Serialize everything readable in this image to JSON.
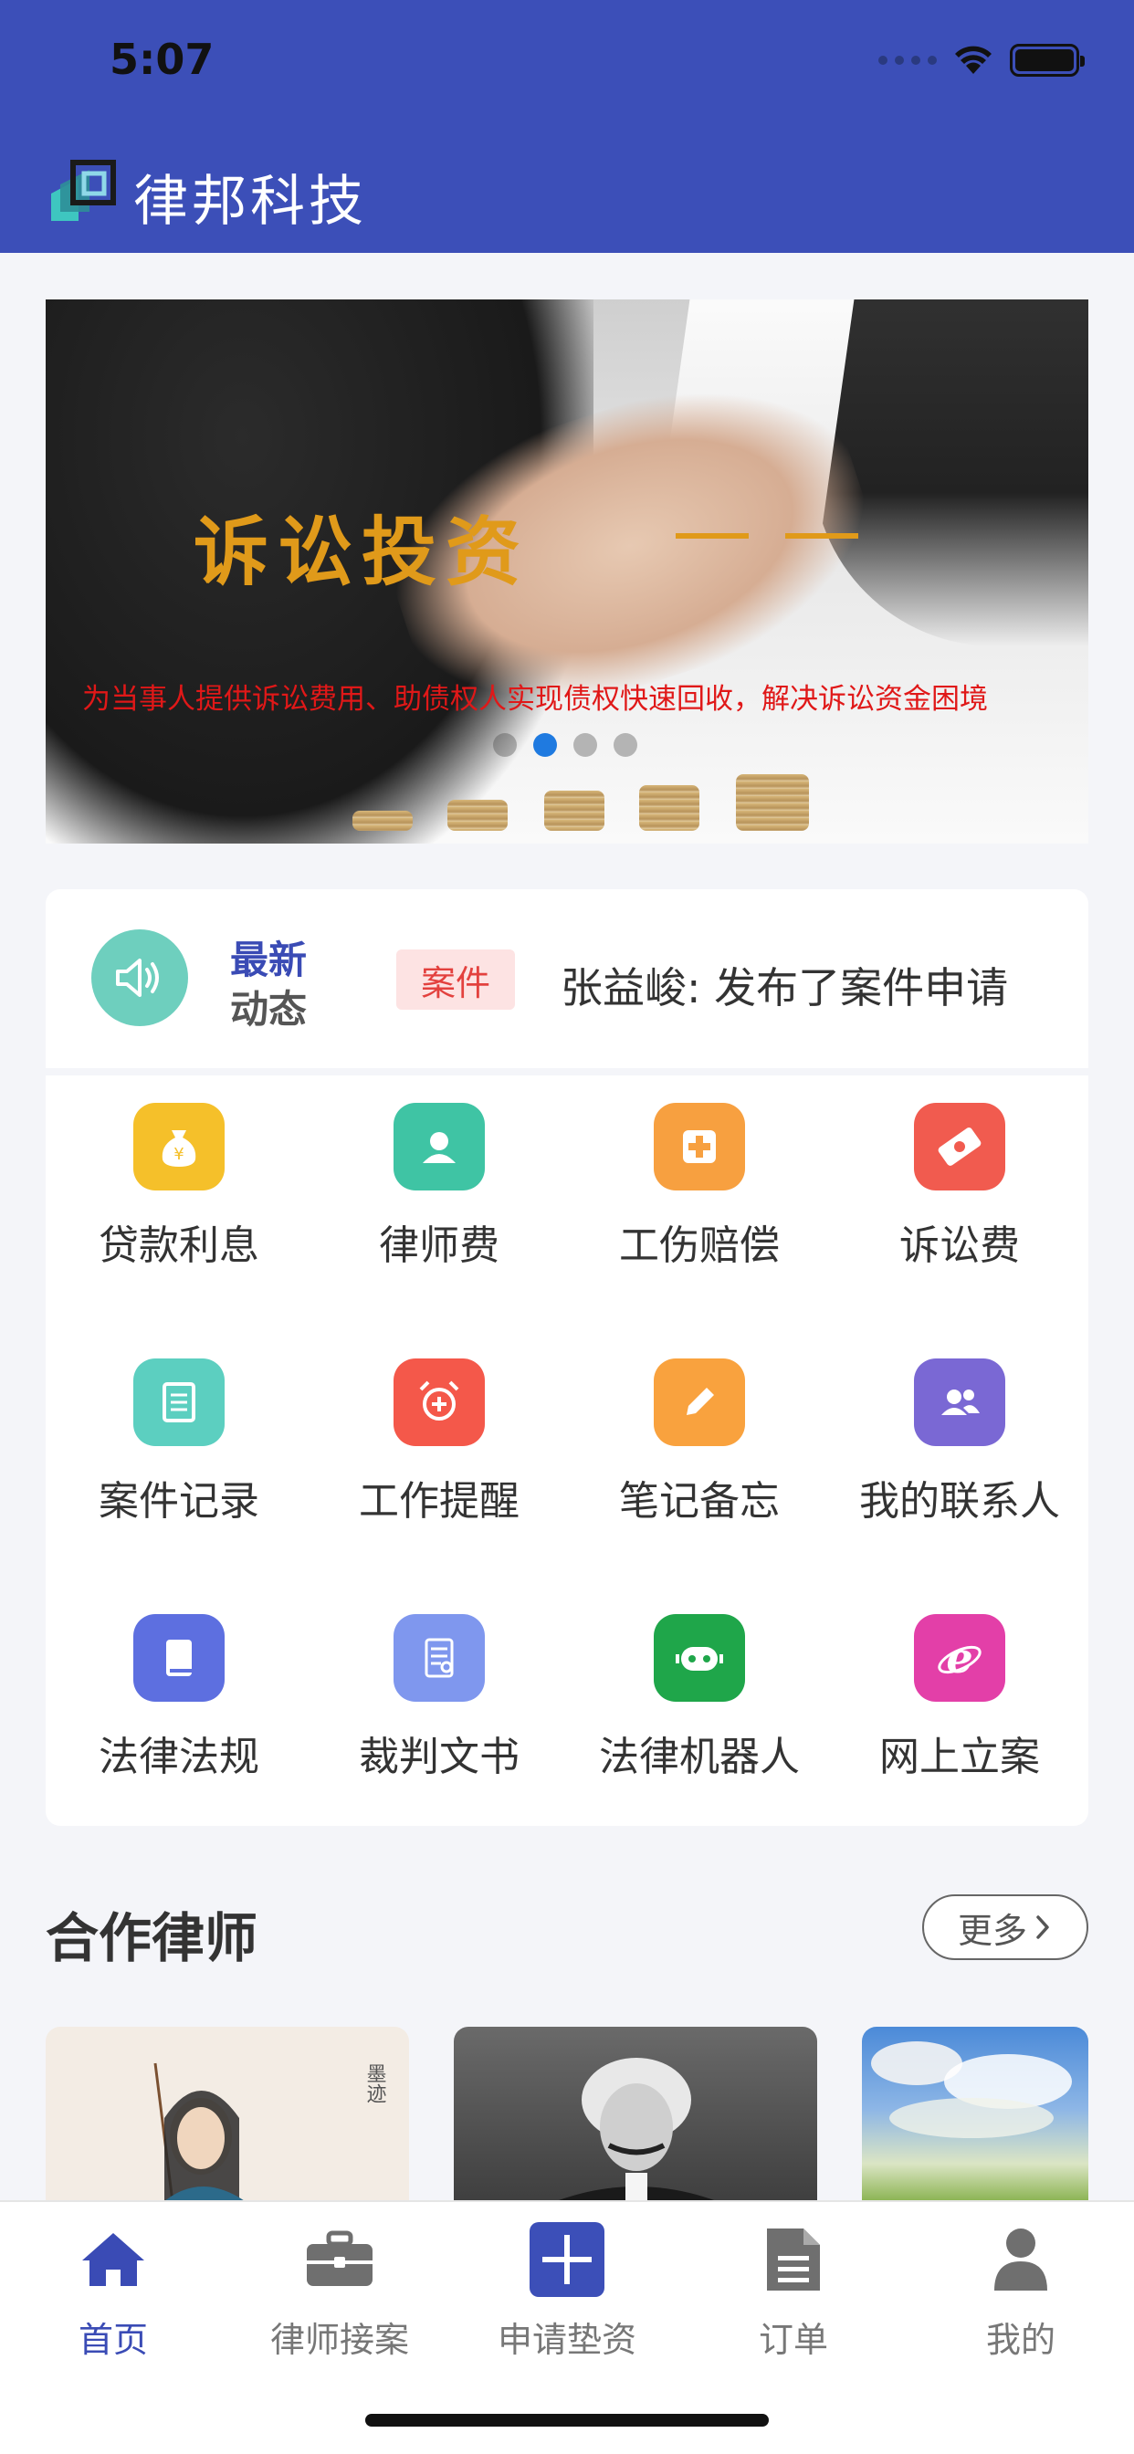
{
  "status_bar": {
    "time": "5:07"
  },
  "header": {
    "app_title": "律邦科技"
  },
  "banner": {
    "title": "诉讼投资",
    "subtitle": "为当事人提供诉讼费用、助债权人实现债权快速回收，解决诉讼资金困境",
    "page_count": 4,
    "active_page": 2
  },
  "news": {
    "label_line1": "最新",
    "label_line2": "动态",
    "tag": "案件",
    "text": "张益峻: 发布了案件申请"
  },
  "grid": {
    "items": [
      {
        "label": "贷款利息",
        "icon": "money-bag-icon",
        "color": "#f5c02a"
      },
      {
        "label": "律师费",
        "icon": "person-icon",
        "color": "#3fc4a4"
      },
      {
        "label": "工伤赔偿",
        "icon": "medical-cross-icon",
        "color": "#f7a040"
      },
      {
        "label": "诉讼费",
        "icon": "ticket-icon",
        "color": "#f15b4f"
      },
      {
        "label": "案件记录",
        "icon": "notebook-icon",
        "color": "#5ccfc0"
      },
      {
        "label": "工作提醒",
        "icon": "alarm-clock-icon",
        "color": "#f4584a"
      },
      {
        "label": "笔记备忘",
        "icon": "pencil-icon",
        "color": "#f9a23e"
      },
      {
        "label": "我的联系人",
        "icon": "contacts-icon",
        "color": "#7a68d4"
      },
      {
        "label": "法律法规",
        "icon": "book-icon",
        "color": "#5d6fe0"
      },
      {
        "label": "裁判文书",
        "icon": "document-icon",
        "color": "#7f97ee"
      },
      {
        "label": "法律机器人",
        "icon": "robot-icon",
        "color": "#1fa64a"
      },
      {
        "label": "网上立案",
        "icon": "ie-icon",
        "color": "#e33fa8"
      }
    ]
  },
  "lawyers": {
    "title": "合作律师",
    "more_label": "更多"
  },
  "tabbar": {
    "tabs": [
      {
        "label": "首页",
        "icon": "home-icon",
        "active": true
      },
      {
        "label": "律师接案",
        "icon": "briefcase-icon",
        "active": false
      },
      {
        "label": "申请垫资",
        "icon": "plus-square-icon",
        "active": false
      },
      {
        "label": "订单",
        "icon": "order-document-icon",
        "active": false
      },
      {
        "label": "我的",
        "icon": "user-icon",
        "active": false
      }
    ]
  },
  "colors": {
    "primary": "#3c4fb8",
    "accent_blue": "#3a4bb5",
    "tag_red": "#e3413e",
    "banner_gold": "#e09a1a"
  }
}
